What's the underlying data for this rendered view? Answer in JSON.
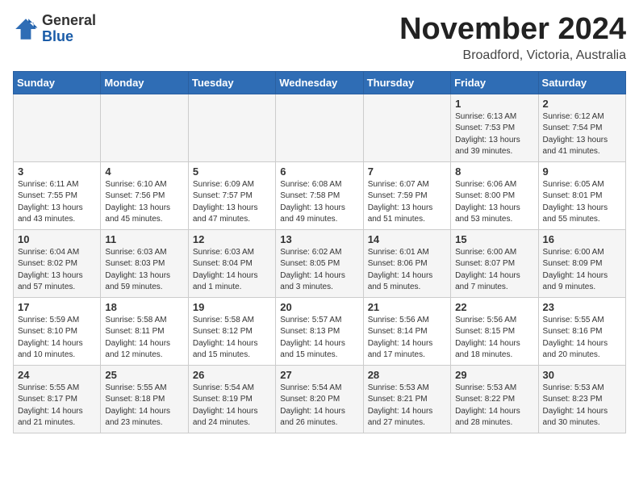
{
  "logo": {
    "general": "General",
    "blue": "Blue"
  },
  "header": {
    "month_year": "November 2024",
    "location": "Broadford, Victoria, Australia"
  },
  "weekdays": [
    "Sunday",
    "Monday",
    "Tuesday",
    "Wednesday",
    "Thursday",
    "Friday",
    "Saturday"
  ],
  "weeks": [
    [
      {
        "day": "",
        "info": ""
      },
      {
        "day": "",
        "info": ""
      },
      {
        "day": "",
        "info": ""
      },
      {
        "day": "",
        "info": ""
      },
      {
        "day": "",
        "info": ""
      },
      {
        "day": "1",
        "info": "Sunrise: 6:13 AM\nSunset: 7:53 PM\nDaylight: 13 hours\nand 39 minutes."
      },
      {
        "day": "2",
        "info": "Sunrise: 6:12 AM\nSunset: 7:54 PM\nDaylight: 13 hours\nand 41 minutes."
      }
    ],
    [
      {
        "day": "3",
        "info": "Sunrise: 6:11 AM\nSunset: 7:55 PM\nDaylight: 13 hours\nand 43 minutes."
      },
      {
        "day": "4",
        "info": "Sunrise: 6:10 AM\nSunset: 7:56 PM\nDaylight: 13 hours\nand 45 minutes."
      },
      {
        "day": "5",
        "info": "Sunrise: 6:09 AM\nSunset: 7:57 PM\nDaylight: 13 hours\nand 47 minutes."
      },
      {
        "day": "6",
        "info": "Sunrise: 6:08 AM\nSunset: 7:58 PM\nDaylight: 13 hours\nand 49 minutes."
      },
      {
        "day": "7",
        "info": "Sunrise: 6:07 AM\nSunset: 7:59 PM\nDaylight: 13 hours\nand 51 minutes."
      },
      {
        "day": "8",
        "info": "Sunrise: 6:06 AM\nSunset: 8:00 PM\nDaylight: 13 hours\nand 53 minutes."
      },
      {
        "day": "9",
        "info": "Sunrise: 6:05 AM\nSunset: 8:01 PM\nDaylight: 13 hours\nand 55 minutes."
      }
    ],
    [
      {
        "day": "10",
        "info": "Sunrise: 6:04 AM\nSunset: 8:02 PM\nDaylight: 13 hours\nand 57 minutes."
      },
      {
        "day": "11",
        "info": "Sunrise: 6:03 AM\nSunset: 8:03 PM\nDaylight: 13 hours\nand 59 minutes."
      },
      {
        "day": "12",
        "info": "Sunrise: 6:03 AM\nSunset: 8:04 PM\nDaylight: 14 hours\nand 1 minute."
      },
      {
        "day": "13",
        "info": "Sunrise: 6:02 AM\nSunset: 8:05 PM\nDaylight: 14 hours\nand 3 minutes."
      },
      {
        "day": "14",
        "info": "Sunrise: 6:01 AM\nSunset: 8:06 PM\nDaylight: 14 hours\nand 5 minutes."
      },
      {
        "day": "15",
        "info": "Sunrise: 6:00 AM\nSunset: 8:07 PM\nDaylight: 14 hours\nand 7 minutes."
      },
      {
        "day": "16",
        "info": "Sunrise: 6:00 AM\nSunset: 8:09 PM\nDaylight: 14 hours\nand 9 minutes."
      }
    ],
    [
      {
        "day": "17",
        "info": "Sunrise: 5:59 AM\nSunset: 8:10 PM\nDaylight: 14 hours\nand 10 minutes."
      },
      {
        "day": "18",
        "info": "Sunrise: 5:58 AM\nSunset: 8:11 PM\nDaylight: 14 hours\nand 12 minutes."
      },
      {
        "day": "19",
        "info": "Sunrise: 5:58 AM\nSunset: 8:12 PM\nDaylight: 14 hours\nand 15 minutes."
      },
      {
        "day": "20",
        "info": "Sunrise: 5:57 AM\nSunset: 8:13 PM\nDaylight: 14 hours\nand 15 minutes."
      },
      {
        "day": "21",
        "info": "Sunrise: 5:56 AM\nSunset: 8:14 PM\nDaylight: 14 hours\nand 17 minutes."
      },
      {
        "day": "22",
        "info": "Sunrise: 5:56 AM\nSunset: 8:15 PM\nDaylight: 14 hours\nand 18 minutes."
      },
      {
        "day": "23",
        "info": "Sunrise: 5:55 AM\nSunset: 8:16 PM\nDaylight: 14 hours\nand 20 minutes."
      }
    ],
    [
      {
        "day": "24",
        "info": "Sunrise: 5:55 AM\nSunset: 8:17 PM\nDaylight: 14 hours\nand 21 minutes."
      },
      {
        "day": "25",
        "info": "Sunrise: 5:55 AM\nSunset: 8:18 PM\nDaylight: 14 hours\nand 23 minutes."
      },
      {
        "day": "26",
        "info": "Sunrise: 5:54 AM\nSunset: 8:19 PM\nDaylight: 14 hours\nand 24 minutes."
      },
      {
        "day": "27",
        "info": "Sunrise: 5:54 AM\nSunset: 8:20 PM\nDaylight: 14 hours\nand 26 minutes."
      },
      {
        "day": "28",
        "info": "Sunrise: 5:53 AM\nSunset: 8:21 PM\nDaylight: 14 hours\nand 27 minutes."
      },
      {
        "day": "29",
        "info": "Sunrise: 5:53 AM\nSunset: 8:22 PM\nDaylight: 14 hours\nand 28 minutes."
      },
      {
        "day": "30",
        "info": "Sunrise: 5:53 AM\nSunset: 8:23 PM\nDaylight: 14 hours\nand 30 minutes."
      }
    ]
  ]
}
